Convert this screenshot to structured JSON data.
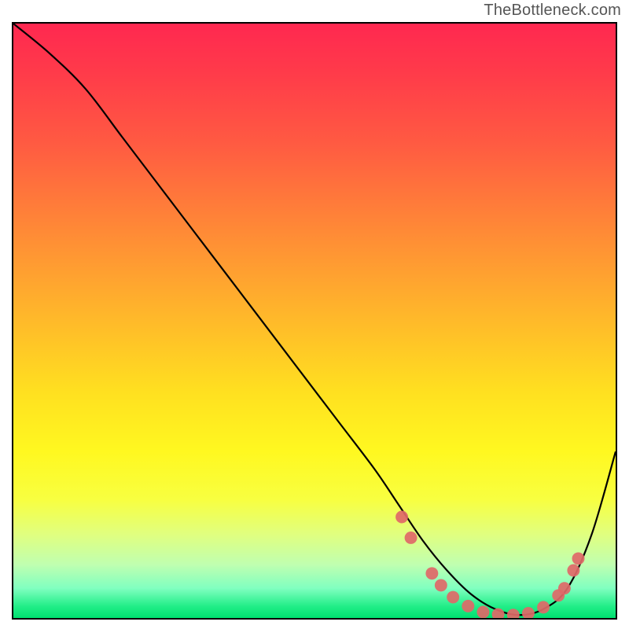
{
  "watermark": "TheBottleneck.com",
  "chart_data": {
    "type": "line",
    "title": "",
    "xlabel": "",
    "ylabel": "",
    "xlim": [
      0,
      100
    ],
    "ylim": [
      0,
      100
    ],
    "grid": false,
    "legend": false,
    "series": [
      {
        "name": "curve",
        "x": [
          0,
          6,
          12,
          18,
          24,
          30,
          36,
          42,
          48,
          54,
          60,
          64,
          68,
          72,
          76,
          80,
          84,
          88,
          92,
          96,
          100
        ],
        "values": [
          100,
          95,
          89,
          81,
          73,
          65,
          57,
          49,
          41,
          33,
          25,
          19,
          13,
          8,
          4,
          1.5,
          0.5,
          1.5,
          5,
          14,
          28
        ]
      }
    ],
    "markers": [
      {
        "x": 64.5,
        "y": 17
      },
      {
        "x": 66.0,
        "y": 13.5
      },
      {
        "x": 69.5,
        "y": 7.5
      },
      {
        "x": 71.0,
        "y": 5.5
      },
      {
        "x": 73.0,
        "y": 3.5
      },
      {
        "x": 75.5,
        "y": 2.0
      },
      {
        "x": 78.0,
        "y": 1.0
      },
      {
        "x": 80.5,
        "y": 0.6
      },
      {
        "x": 83.0,
        "y": 0.5
      },
      {
        "x": 85.5,
        "y": 0.8
      },
      {
        "x": 88.0,
        "y": 1.8
      },
      {
        "x": 90.5,
        "y": 3.8
      },
      {
        "x": 91.5,
        "y": 5.0
      },
      {
        "x": 93.0,
        "y": 8.0
      },
      {
        "x": 93.8,
        "y": 10.0
      }
    ],
    "background_gradient": {
      "top_color": "#ff2850",
      "mid_color": "#fff820",
      "bottom_color": "#00e070"
    }
  }
}
